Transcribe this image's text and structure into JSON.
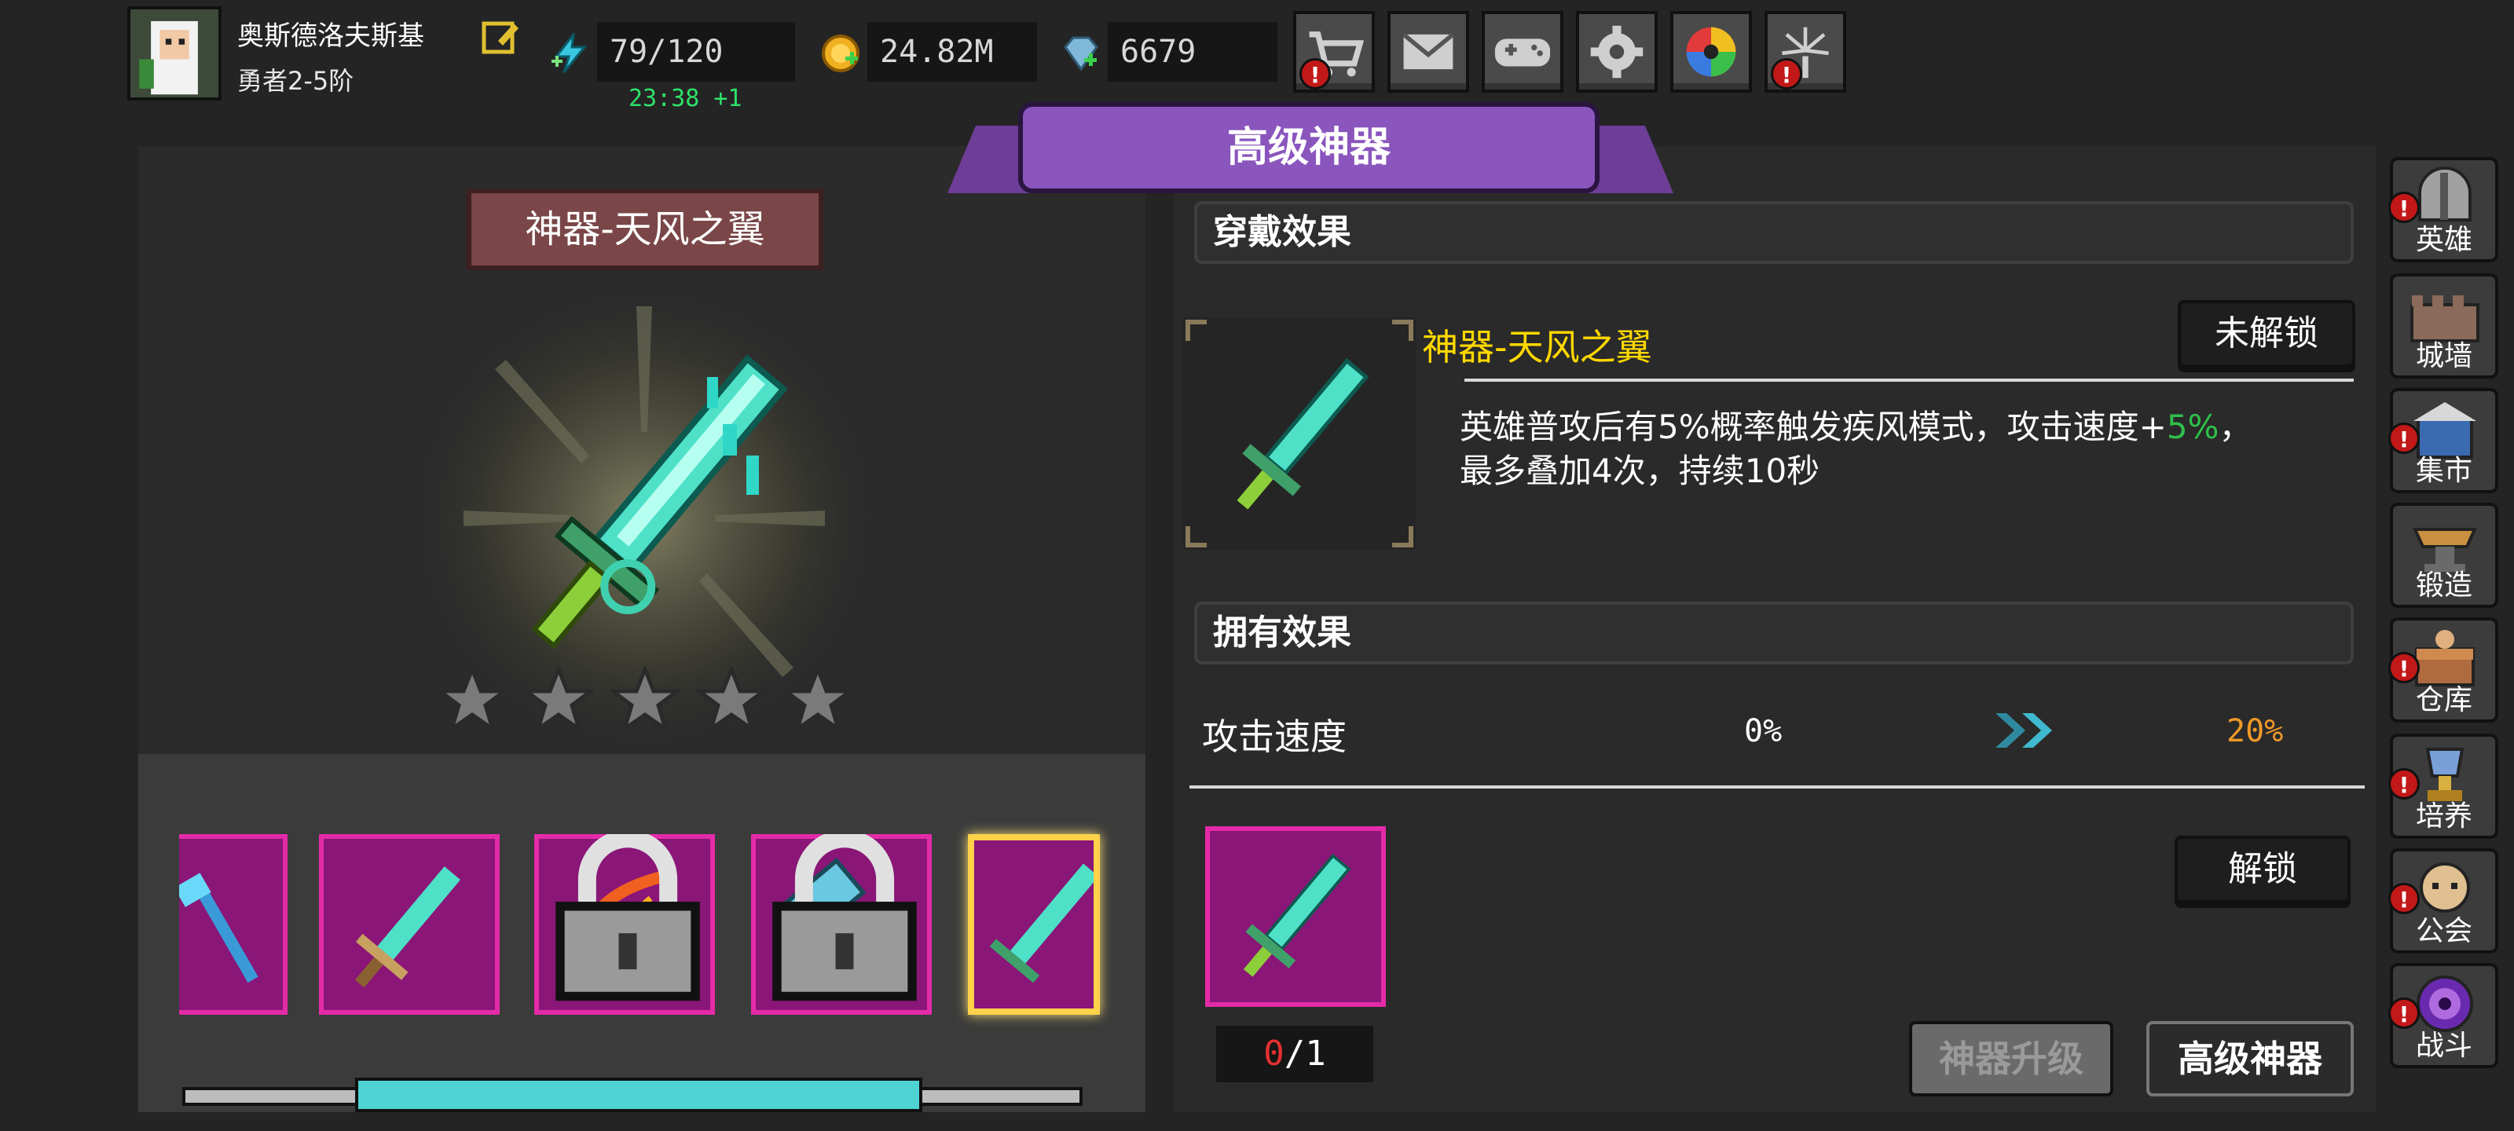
{
  "header": {
    "player_name": "奥斯德洛夫斯基",
    "player_rank": "勇者2-5阶",
    "energy": "79/120",
    "energy_timer": "23:38 +1",
    "gold": "24.82M",
    "gems": "6679",
    "top_buttons": [
      "shop",
      "mail",
      "gamepad",
      "settings",
      "lucky-wheel",
      "fireworks"
    ]
  },
  "title": "高级神器",
  "artifact": {
    "name": "神器-天风之翼",
    "star_count": 5
  },
  "wear_effect": {
    "section_title": "穿戴效果",
    "item_name": "神器-天风之翼",
    "lock_status": "未解锁",
    "desc_line1_prefix": "英雄普攻后有5%概率触发疾风模式，攻击速度+",
    "desc_line1_value": "5%",
    "desc_line1_suffix": "，",
    "desc_line2": "最多叠加4次，持续10秒"
  },
  "own_effect": {
    "section_title": "拥有效果",
    "stat_name": "攻击速度",
    "current": "0%",
    "next": "20%"
  },
  "own_count": {
    "current": "0",
    "separator": "/",
    "total": "1"
  },
  "buttons": {
    "unlock": "解锁",
    "upgrade": "神器升级",
    "advanced": "高级神器"
  },
  "side_menu": [
    {
      "label": "英雄",
      "icon": "helmet-icon",
      "alert": true
    },
    {
      "label": "城墙",
      "icon": "wall-icon",
      "alert": false
    },
    {
      "label": "集市",
      "icon": "market-icon",
      "alert": true
    },
    {
      "label": "锻造",
      "icon": "anvil-icon",
      "alert": false
    },
    {
      "label": "仓库",
      "icon": "chest-icon",
      "alert": true
    },
    {
      "label": "培养",
      "icon": "trophy-icon",
      "alert": true
    },
    {
      "label": "公会",
      "icon": "guild-icon",
      "alert": true
    },
    {
      "label": "战斗",
      "icon": "portal-icon",
      "alert": true
    }
  ],
  "colors": {
    "accent_purple": "#8a55bd",
    "slot_magenta": "#8a1677",
    "slot_border": "#e32ba8",
    "highlight_green": "#2fe26b",
    "title_yellow": "#ffd800",
    "value_orange": "#f09a28",
    "alert_red": "#c21818"
  }
}
